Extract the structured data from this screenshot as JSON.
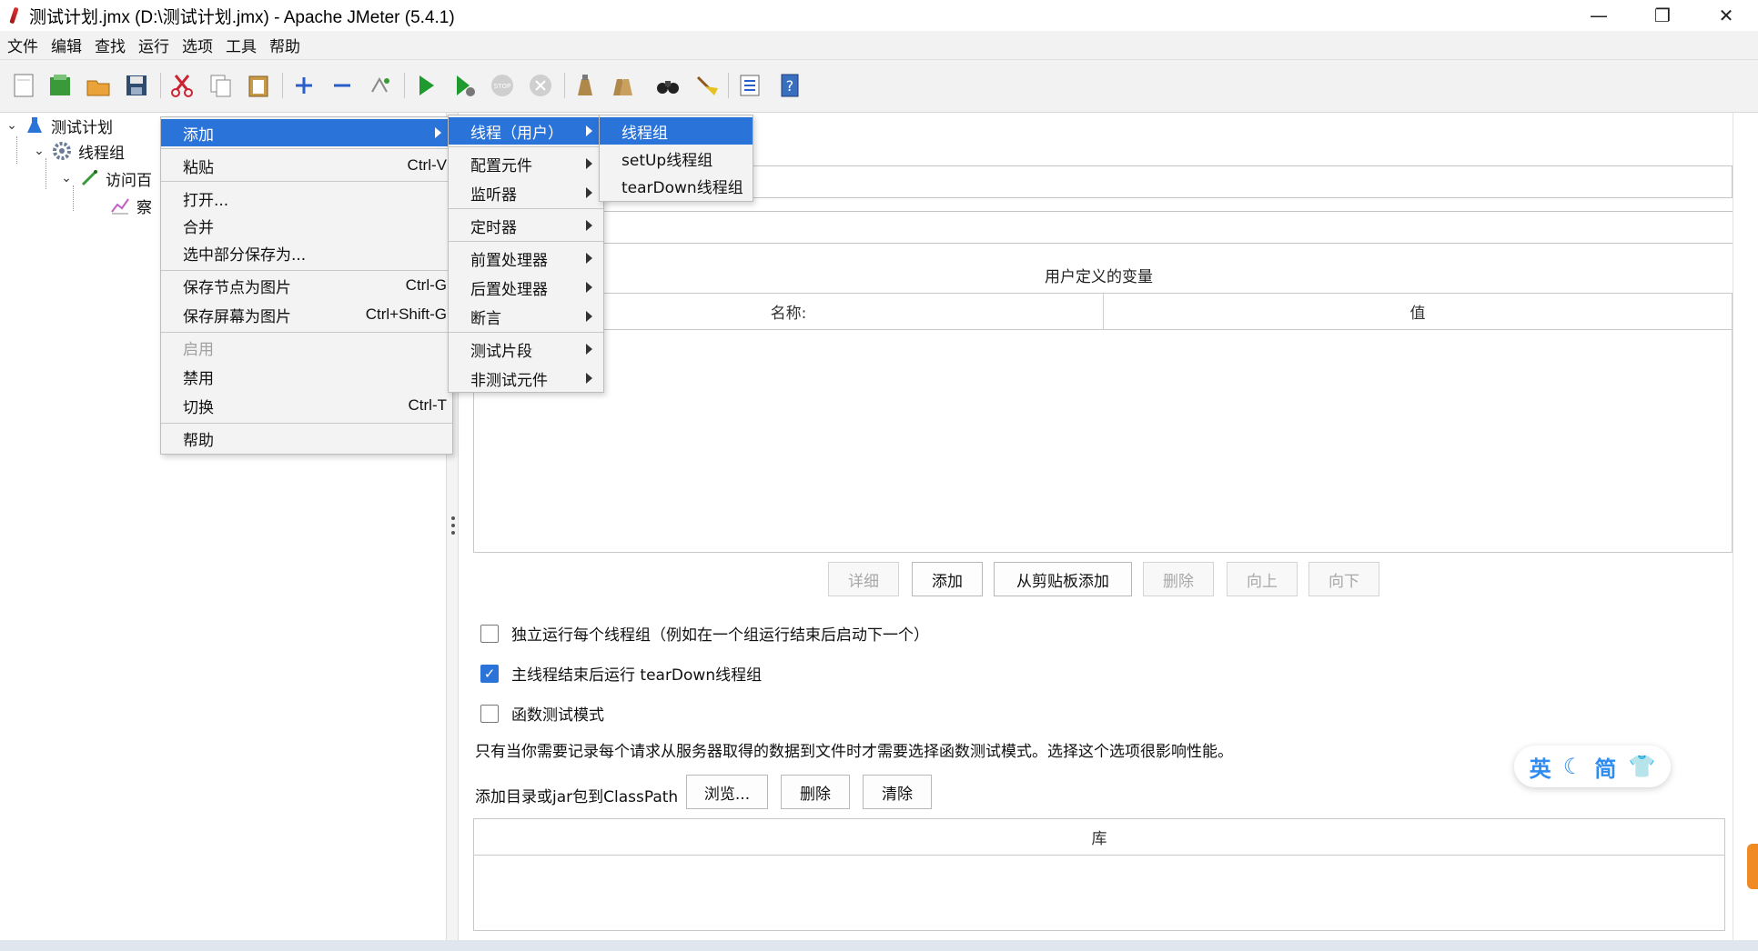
{
  "window": {
    "title": "测试计划.jmx (D:\\测试计划.jmx) - Apache JMeter (5.4.1)",
    "minimize": "—",
    "restore": "❐",
    "close": "✕"
  },
  "menubar": [
    "文件",
    "编辑",
    "查找",
    "运行",
    "选项",
    "工具",
    "帮助"
  ],
  "tree": {
    "root": "测试计划",
    "thread_group": "线程组",
    "sampler": "访问百",
    "listener": "察"
  },
  "context_menu": {
    "items": [
      {
        "label": "添加",
        "shortcut": ""
      },
      {
        "label": "粘贴",
        "shortcut": "Ctrl-V"
      },
      {
        "label": "打开...",
        "shortcut": ""
      },
      {
        "label": "合并",
        "shortcut": ""
      },
      {
        "label": "选中部分保存为...",
        "shortcut": ""
      },
      {
        "label": "保存节点为图片",
        "shortcut": "Ctrl-G"
      },
      {
        "label": "保存屏幕为图片",
        "shortcut": "Ctrl+Shift-G"
      },
      {
        "label": "启用",
        "shortcut": ""
      },
      {
        "label": "禁用",
        "shortcut": ""
      },
      {
        "label": "切换",
        "shortcut": "Ctrl-T"
      },
      {
        "label": "帮助",
        "shortcut": ""
      }
    ]
  },
  "add_submenu": {
    "items": [
      "线程（用户）",
      "配置元件",
      "监听器",
      "定时器",
      "前置处理器",
      "后置处理器",
      "断言",
      "测试片段",
      "非测试元件"
    ]
  },
  "thread_submenu": {
    "items": [
      "线程组",
      "setUp线程组",
      "tearDown线程组"
    ]
  },
  "main": {
    "variables_title": "用户定义的变量",
    "columns": [
      "名称:",
      "值"
    ],
    "buttons": {
      "detail": "详细",
      "add": "添加",
      "add_from_clipboard": "从剪贴板添加",
      "delete": "删除",
      "up": "向上",
      "down": "向下"
    },
    "checkboxes": [
      {
        "label": "独立运行每个线程组（例如在一个组运行结束后启动下一个）",
        "checked": false
      },
      {
        "label": "主线程结束后运行 tearDown线程组",
        "checked": true
      },
      {
        "label": "函数测试模式",
        "checked": false
      }
    ],
    "functional_note": "只有当你需要记录每个请求从服务器取得的数据到文件时才需要选择函数测试模式。选择这个选项很影响性能。",
    "classpath_label": "添加目录或jar包到ClassPath",
    "classpath_buttons": {
      "browse": "浏览...",
      "delete": "删除",
      "clear": "清除"
    },
    "library_column": "库"
  },
  "ime": {
    "lang": "英",
    "mode": "简"
  },
  "colors": {
    "accent": "#2a73d9",
    "menu_bg": "#f3f3f3",
    "toolbar_bg": "#f2f2f2"
  }
}
